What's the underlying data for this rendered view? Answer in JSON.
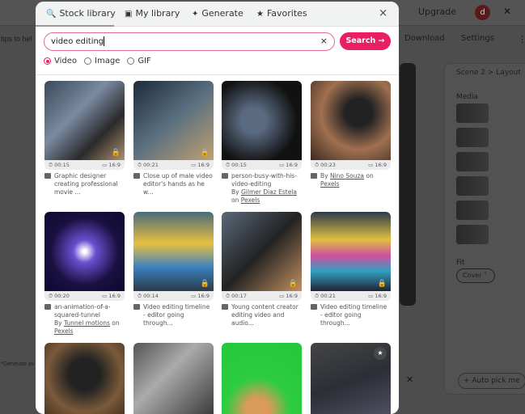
{
  "background": {
    "upgrade": "Upgrade",
    "avatar": "d",
    "tips": "tips to hel",
    "download": "Download",
    "settings": "Settings",
    "breadcrumb": "Scene 2  >  Layout",
    "media": "Media",
    "fit": "Fit",
    "cover": "Cover ˅",
    "auto_pick": "+ Auto pick me",
    "note": "*Generate av"
  },
  "modal": {
    "tabs": [
      {
        "icon": "🔍",
        "label": "Stock library"
      },
      {
        "icon": "▣",
        "label": "My library"
      },
      {
        "icon": "✦",
        "label": "Generate"
      },
      {
        "icon": "★",
        "label": "Favorites"
      }
    ],
    "close": "×",
    "search": {
      "value": "video editing",
      "clear": "×",
      "button": "Search →"
    },
    "media_types": [
      {
        "label": "Video",
        "selected": true
      },
      {
        "label": "Image",
        "selected": false
      },
      {
        "label": "GIF",
        "selected": false
      }
    ],
    "results": [
      {
        "duration": "00:15",
        "ratio": "16:9",
        "title": "Graphic designer creating professional movie ...",
        "by": "",
        "author": "",
        "source": "",
        "locked": true
      },
      {
        "duration": "00:21",
        "ratio": "16:9",
        "title": "Close up of male video editor's hands as he w...",
        "by": "",
        "author": "",
        "source": "",
        "locked": true
      },
      {
        "duration": "00:15",
        "ratio": "16:9",
        "title": "person-busy-with-his-video-editing",
        "by": "By ",
        "author": "Gilmer Diaz Estela",
        "source": "Pexels",
        "locked": false
      },
      {
        "duration": "00:23",
        "ratio": "16:9",
        "title": "",
        "by": "By ",
        "author": "Nino Souza",
        "source": "Pexels",
        "locked": false
      },
      {
        "duration": "00:20",
        "ratio": "16:9",
        "title": "an-animation-of-a-squared-tunnel",
        "by": "By ",
        "author": "Tunnel motions",
        "source": "Pexels",
        "locked": false
      },
      {
        "duration": "00:14",
        "ratio": "16:9",
        "title": "Video editing timeline - editor going through...",
        "by": "",
        "author": "",
        "source": "",
        "locked": true
      },
      {
        "duration": "00:17",
        "ratio": "16:9",
        "title": "Young content creator editing video and audio...",
        "by": "",
        "author": "",
        "source": "",
        "locked": true
      },
      {
        "duration": "00:21",
        "ratio": "16:9",
        "title": "Video editing timeline - editor going through...",
        "by": "",
        "author": "",
        "source": "",
        "locked": true
      }
    ],
    "on_word": " on ",
    "lock_icon": "🔒"
  },
  "colors": {
    "accent": "#e91e63"
  }
}
